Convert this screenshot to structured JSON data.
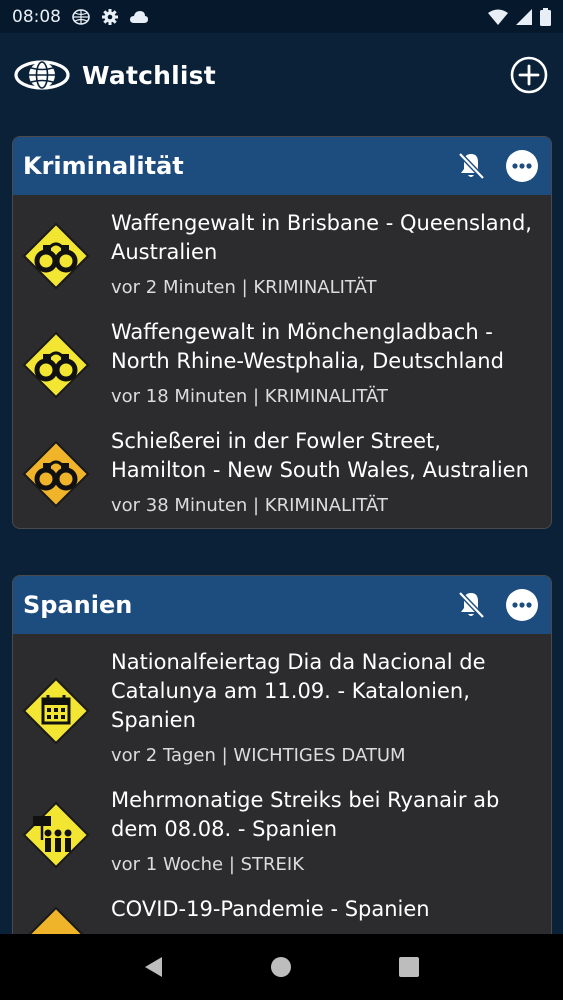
{
  "status_bar": {
    "time": "08:08",
    "icons": [
      "globe-icon",
      "gear-icon",
      "cloud-icon",
      "wifi-icon",
      "signal-icon",
      "battery-icon"
    ]
  },
  "app_bar": {
    "title": "Watchlist",
    "logo": "globe-logo-icon",
    "add_icon": "add-circle-icon"
  },
  "colors": {
    "background": "#0b2138",
    "card_header": "#1d4d7f",
    "card_body": "#2c2c2e",
    "alert_yellow": "#f2e633",
    "alert_orange": "#f0b42a"
  },
  "cards": [
    {
      "title": "Kriminalität",
      "items": [
        {
          "title": "Waffengewalt in Brisbane - Queensland, Australien",
          "meta": "vor 2 Minuten | KRIMINALITÄT",
          "icon": "handcuffs-icon"
        },
        {
          "title": "Waffengewalt in Mönchengladbach - North Rhine-Westphalia, Deutschland",
          "meta": "vor 18 Minuten | KRIMINALITÄT",
          "icon": "handcuffs-icon"
        },
        {
          "title": "Schießerei in der Fowler Street, Hamilton - New South Wales, Australien",
          "meta": "vor 38 Minuten | KRIMINALITÄT",
          "icon": "handcuffs-icon"
        }
      ]
    },
    {
      "title": "Spanien",
      "items": [
        {
          "title": "Nationalfeiertag Dia da Nacional de Catalunya am 11.09. - Katalonien, Spanien",
          "meta": "vor 2 Tagen | WICHTIGES DATUM",
          "icon": "calendar-icon"
        },
        {
          "title": "Mehrmonatige Streiks bei Ryanair ab dem 08.08. - Spanien",
          "meta": "vor 1 Woche | STREIK",
          "icon": "strike-icon"
        },
        {
          "title": "COVID-19-Pandemie - Spanien",
          "meta": "",
          "icon": "health-icon"
        }
      ]
    }
  ],
  "nav_bar": {
    "icons": [
      "back-icon",
      "home-icon",
      "recents-icon"
    ]
  }
}
